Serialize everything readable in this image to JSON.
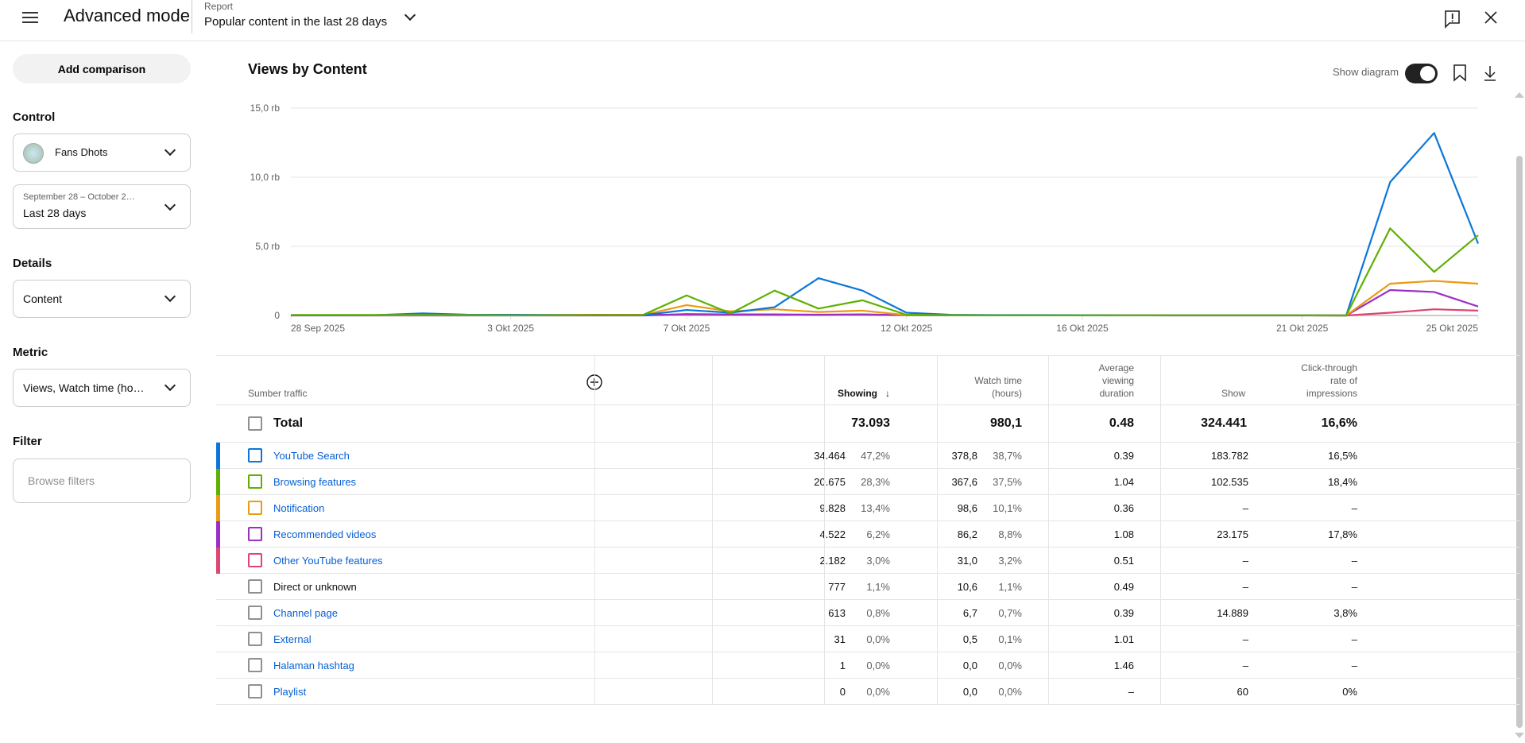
{
  "header": {
    "title": "Advanced mode",
    "report_label": "Report",
    "report_title": "Popular content in the last 28 days"
  },
  "sidebar": {
    "add_comparison": "Add comparison",
    "control_label": "Control",
    "channel": "Fans Dhots",
    "date_range": "September 28 – October 2…",
    "date_preset": "Last 28 days",
    "details_label": "Details",
    "details_value": "Content",
    "metric_label": "Metric",
    "metric_value": "Views, Watch time (ho…",
    "filter_label": "Filter",
    "filter_placeholder": "Browse filters"
  },
  "main": {
    "title": "Views by Content",
    "show_diagram": "Show diagram",
    "show_diagram_on": true
  },
  "colors": {
    "youtube_search": "#0b76d8",
    "browsing": "#5fb000",
    "notification": "#ec9a12",
    "recommended": "#9a2fc7",
    "other": "#dc4670",
    "link": "#065fd4"
  },
  "chart_data": {
    "type": "line",
    "ylim": [
      0,
      15000
    ],
    "grid": true,
    "yticks": [
      {
        "v": 0,
        "label": "0"
      },
      {
        "v": 5000,
        "label": "5,0 rb"
      },
      {
        "v": 10000,
        "label": "10,0 rb"
      },
      {
        "v": 15000,
        "label": "15,0 rb"
      }
    ],
    "x": [
      "2025-09-28",
      "2025-09-29",
      "2025-09-30",
      "2025-10-01",
      "2025-10-02",
      "2025-10-03",
      "2025-10-04",
      "2025-10-05",
      "2025-10-06",
      "2025-10-07",
      "2025-10-08",
      "2025-10-09",
      "2025-10-10",
      "2025-10-11",
      "2025-10-12",
      "2025-10-13",
      "2025-10-14",
      "2025-10-15",
      "2025-10-16",
      "2025-10-17",
      "2025-10-18",
      "2025-10-19",
      "2025-10-20",
      "2025-10-21",
      "2025-10-22",
      "2025-10-23",
      "2025-10-24",
      "2025-10-25"
    ],
    "xticks": [
      {
        "i": 0,
        "label": "28 Sep 2025"
      },
      {
        "i": 5,
        "label": "3 Okt 2025"
      },
      {
        "i": 9,
        "label": "7 Okt 2025"
      },
      {
        "i": 14,
        "label": "12 Okt 2025"
      },
      {
        "i": 18,
        "label": "16 Okt 2025"
      },
      {
        "i": 23,
        "label": "21 Okt 2025"
      },
      {
        "i": 27,
        "label": "25 Okt 2025"
      }
    ],
    "series": [
      {
        "name": "Other YouTube features",
        "color": "#dc4670",
        "values": [
          20,
          20,
          20,
          20,
          20,
          20,
          40,
          50,
          50,
          60,
          50,
          50,
          60,
          60,
          30,
          20,
          20,
          20,
          20,
          10,
          10,
          10,
          10,
          10,
          0,
          200,
          450,
          350
        ]
      },
      {
        "name": "Recommended videos",
        "color": "#9a2fc7",
        "values": [
          0,
          0,
          0,
          0,
          0,
          0,
          0,
          0,
          0,
          100,
          80,
          80,
          50,
          80,
          20,
          10,
          10,
          10,
          10,
          10,
          0,
          0,
          0,
          0,
          0,
          1840,
          1700,
          650
        ]
      },
      {
        "name": "Notification",
        "color": "#ec9a12",
        "values": [
          20,
          20,
          20,
          20,
          20,
          10,
          20,
          30,
          30,
          750,
          300,
          450,
          250,
          350,
          30,
          20,
          20,
          10,
          10,
          10,
          10,
          10,
          10,
          10,
          0,
          2300,
          2500,
          2300
        ]
      },
      {
        "name": "YouTube Search",
        "color": "#0b76d8",
        "values": [
          30,
          30,
          40,
          150,
          60,
          50,
          40,
          10,
          20,
          400,
          200,
          600,
          2700,
          1800,
          200,
          50,
          30,
          30,
          20,
          10,
          10,
          10,
          10,
          10,
          0,
          9650,
          13200,
          5200
        ]
      },
      {
        "name": "Browsing features",
        "color": "#5fb000",
        "values": [
          40,
          40,
          40,
          40,
          30,
          10,
          20,
          30,
          30,
          1450,
          150,
          1800,
          500,
          1100,
          50,
          20,
          10,
          10,
          10,
          10,
          10,
          10,
          10,
          10,
          0,
          6300,
          3150,
          5800
        ]
      }
    ]
  },
  "table": {
    "headers": {
      "source": "Sumber traffic",
      "views": "Showing",
      "watch1": "Watch time",
      "watch2": "(hours)",
      "avg1": "Average",
      "avg2": "viewing",
      "avg3": "duration",
      "show": "Show",
      "ctr1": "Click-through",
      "ctr2": "rate of",
      "ctr3": "impressions"
    },
    "total": {
      "label": "Total",
      "views": "73.093",
      "watch": "980,1",
      "avg": "0.48",
      "show": "324.441",
      "ctr": "16,6%"
    },
    "rows": [
      {
        "name": "YouTube Search",
        "color": "#0b76d8",
        "link": true,
        "views": "34.464",
        "views_pct": "47,2%",
        "watch": "378,8",
        "watch_pct": "38,7%",
        "avg": "0.39",
        "show": "183.782",
        "ctr": "16,5%"
      },
      {
        "name": "Browsing features",
        "color": "#5fb000",
        "link": true,
        "views": "20.675",
        "views_pct": "28,3%",
        "watch": "367,6",
        "watch_pct": "37,5%",
        "avg": "1.04",
        "show": "102.535",
        "ctr": "18,4%"
      },
      {
        "name": "Notification",
        "color": "#ec9a12",
        "link": true,
        "views": "9.828",
        "views_pct": "13,4%",
        "watch": "98,6",
        "watch_pct": "10,1%",
        "avg": "0.36",
        "show": "–",
        "ctr": "–"
      },
      {
        "name": "Recommended videos",
        "color": "#9a2fc7",
        "link": true,
        "views": "4.522",
        "views_pct": "6,2%",
        "watch": "86,2",
        "watch_pct": "8,8%",
        "avg": "1.08",
        "show": "23.175",
        "ctr": "17,8%"
      },
      {
        "name": "Other YouTube features",
        "color": "#dc4670",
        "link": true,
        "views": "2.182",
        "views_pct": "3,0%",
        "watch": "31,0",
        "watch_pct": "3,2%",
        "avg": "0.51",
        "show": "–",
        "ctr": "–"
      },
      {
        "name": "Direct or unknown",
        "color": "",
        "link": false,
        "views": "777",
        "views_pct": "1,1%",
        "watch": "10,6",
        "watch_pct": "1,1%",
        "avg": "0.49",
        "show": "–",
        "ctr": "–"
      },
      {
        "name": "Channel page",
        "color": "",
        "link": true,
        "views": "613",
        "views_pct": "0,8%",
        "watch": "6,7",
        "watch_pct": "0,7%",
        "avg": "0.39",
        "show": "14.889",
        "ctr": "3,8%"
      },
      {
        "name": "External",
        "color": "",
        "link": true,
        "views": "31",
        "views_pct": "0,0%",
        "watch": "0,5",
        "watch_pct": "0,1%",
        "avg": "1.01",
        "show": "–",
        "ctr": "–"
      },
      {
        "name": "Halaman hashtag",
        "color": "",
        "link": true,
        "views": "1",
        "views_pct": "0,0%",
        "watch": "0,0",
        "watch_pct": "0,0%",
        "avg": "1.46",
        "show": "–",
        "ctr": "–"
      },
      {
        "name": "Playlist",
        "color": "",
        "link": true,
        "views": "0",
        "views_pct": "0,0%",
        "watch": "0,0",
        "watch_pct": "0,0%",
        "avg": "–",
        "show": "60",
        "ctr": "0%"
      }
    ]
  }
}
